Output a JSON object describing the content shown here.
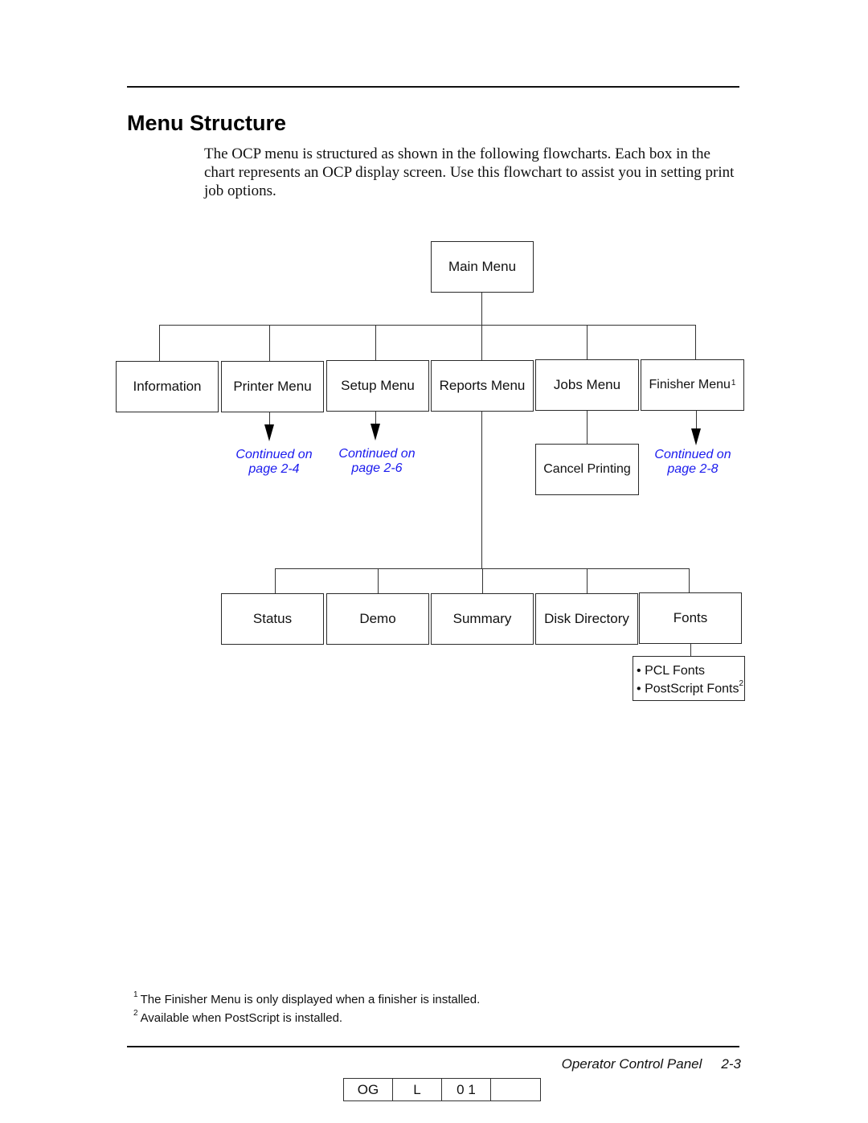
{
  "page": {
    "title": "Menu Structure",
    "intro_lines": [
      "The OCP menu is structured as shown in the following flowcharts. Each box in the",
      "chart represents an OCP display screen. Use this flowchart to assist you in setting print",
      "job options."
    ]
  },
  "diagram": {
    "root": "Main Menu",
    "level1": [
      {
        "label": "Information",
        "sup": ""
      },
      {
        "label": "Printer Menu",
        "sup": ""
      },
      {
        "label": "Setup Menu",
        "sup": ""
      },
      {
        "label": "Reports Menu",
        "sup": ""
      },
      {
        "label": "Jobs Menu",
        "sup": ""
      },
      {
        "label": "Finisher Menu",
        "sup": "1"
      }
    ],
    "continuations": [
      {
        "from": "Printer Menu",
        "line1": "Continued on",
        "line2": "page 2-4"
      },
      {
        "from": "Setup Menu",
        "line1": "Continued on",
        "line2": "page 2-6"
      },
      {
        "from": "Finisher Menu",
        "line1": "Continued on",
        "line2": "page 2-8"
      }
    ],
    "jobs_children": [
      "Cancel Printing"
    ],
    "reports_children": [
      "Status",
      "Demo",
      "Summary",
      "Disk Directory",
      "Fonts"
    ],
    "fonts_children": [
      {
        "text": "PCL Fonts",
        "sup": ""
      },
      {
        "text": "PostScript Fonts",
        "sup": "2"
      }
    ],
    "bullet": "•",
    "link_color": "#1a1aee"
  },
  "footnotes": [
    {
      "num": "1",
      "text": "The Finisher Menu is only displayed when a finisher is installed."
    },
    {
      "num": "2",
      "text": "Available when PostScript is installed."
    }
  ],
  "footer": {
    "section": "Operator Control Panel",
    "page": "2-3",
    "code_cells": [
      "OG",
      "L",
      "0 1",
      ""
    ]
  }
}
